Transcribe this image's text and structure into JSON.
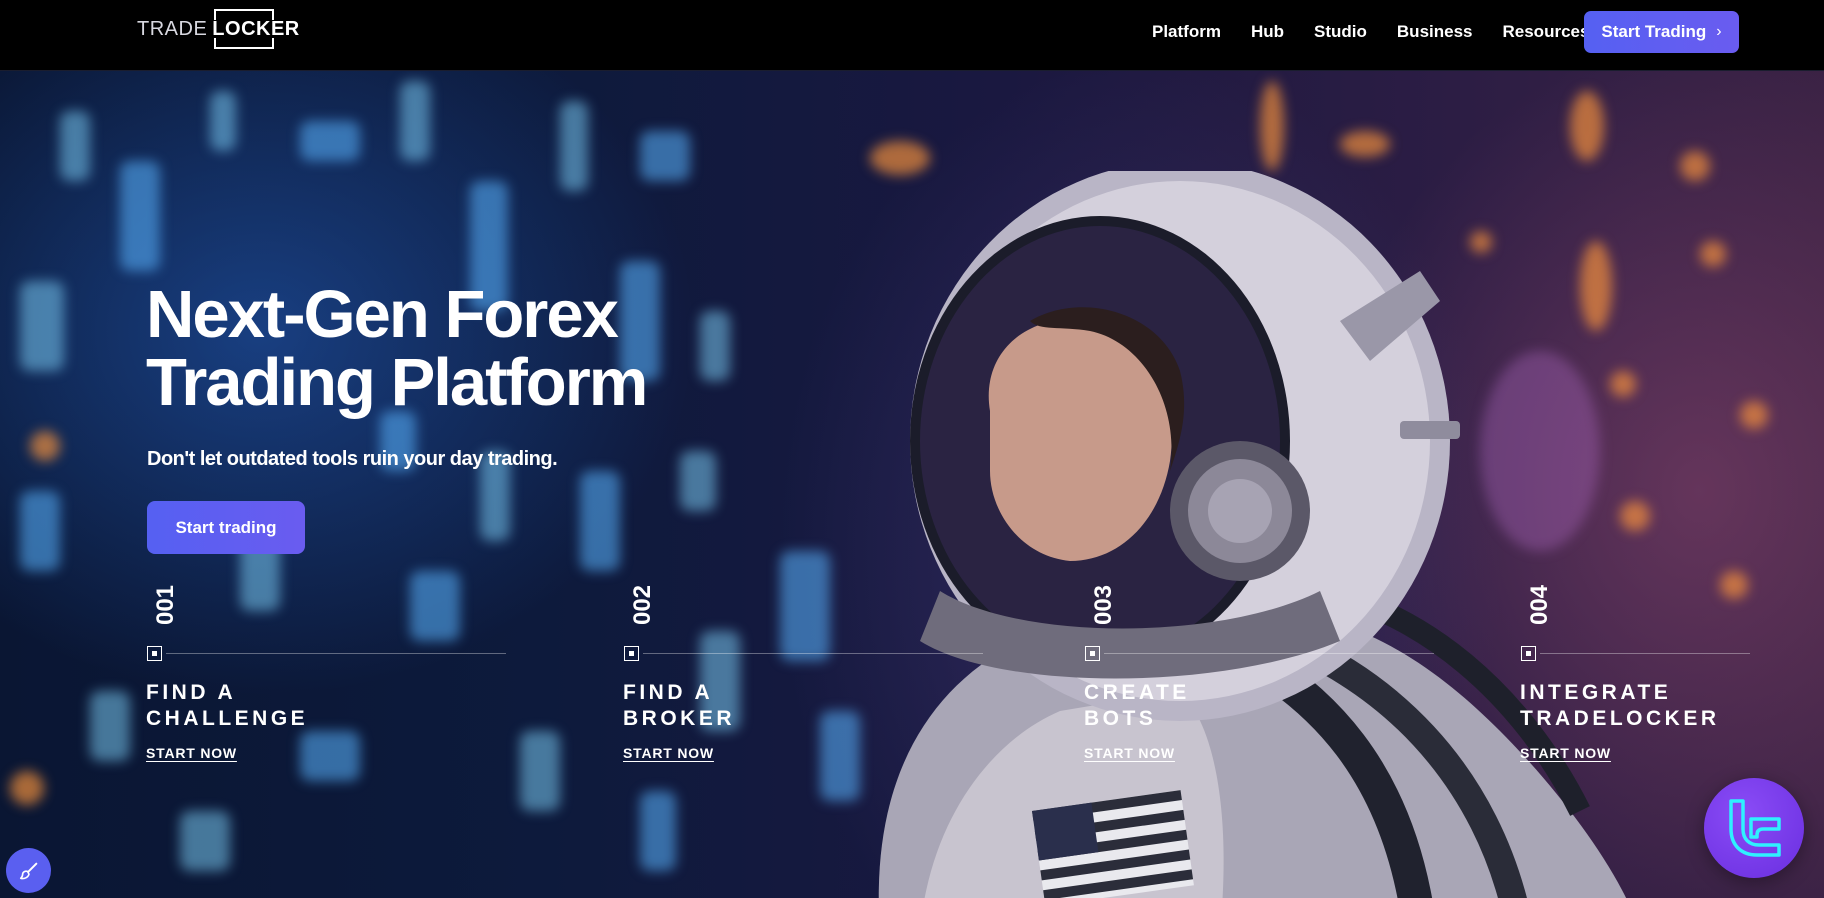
{
  "nav": {
    "logo_trade": "TRADE",
    "logo_locker": "LOCKER",
    "links": [
      {
        "label": "Platform"
      },
      {
        "label": "Hub"
      },
      {
        "label": "Studio"
      },
      {
        "label": "Business"
      },
      {
        "label": "Resources"
      }
    ],
    "cta_label": "Start Trading",
    "cta_icon": "chevron-right-icon"
  },
  "hero": {
    "title_line1": "Next-Gen Forex",
    "title_line2": "Trading Platform",
    "subtitle": "Don't let outdated tools ruin your day trading.",
    "cta_label": "Start trading"
  },
  "features": [
    {
      "number": "001",
      "title": "FIND A\nCHALLENGE",
      "link": "START NOW"
    },
    {
      "number": "002",
      "title": "FIND A\nBROKER",
      "link": "START NOW"
    },
    {
      "number": "003",
      "title": "CREATE\nBOTS",
      "link": "START NOW"
    },
    {
      "number": "004",
      "title": "INTEGRATE\nTRADELOCKER",
      "link": "START NOW"
    }
  ],
  "floating": {
    "left_icon": "brush-icon",
    "right_icon": "tradelocker-logo-icon"
  },
  "colors": {
    "accent": "#5a60f0",
    "nav_bg": "#000000",
    "chat_bubble": "#7a3cf0"
  }
}
